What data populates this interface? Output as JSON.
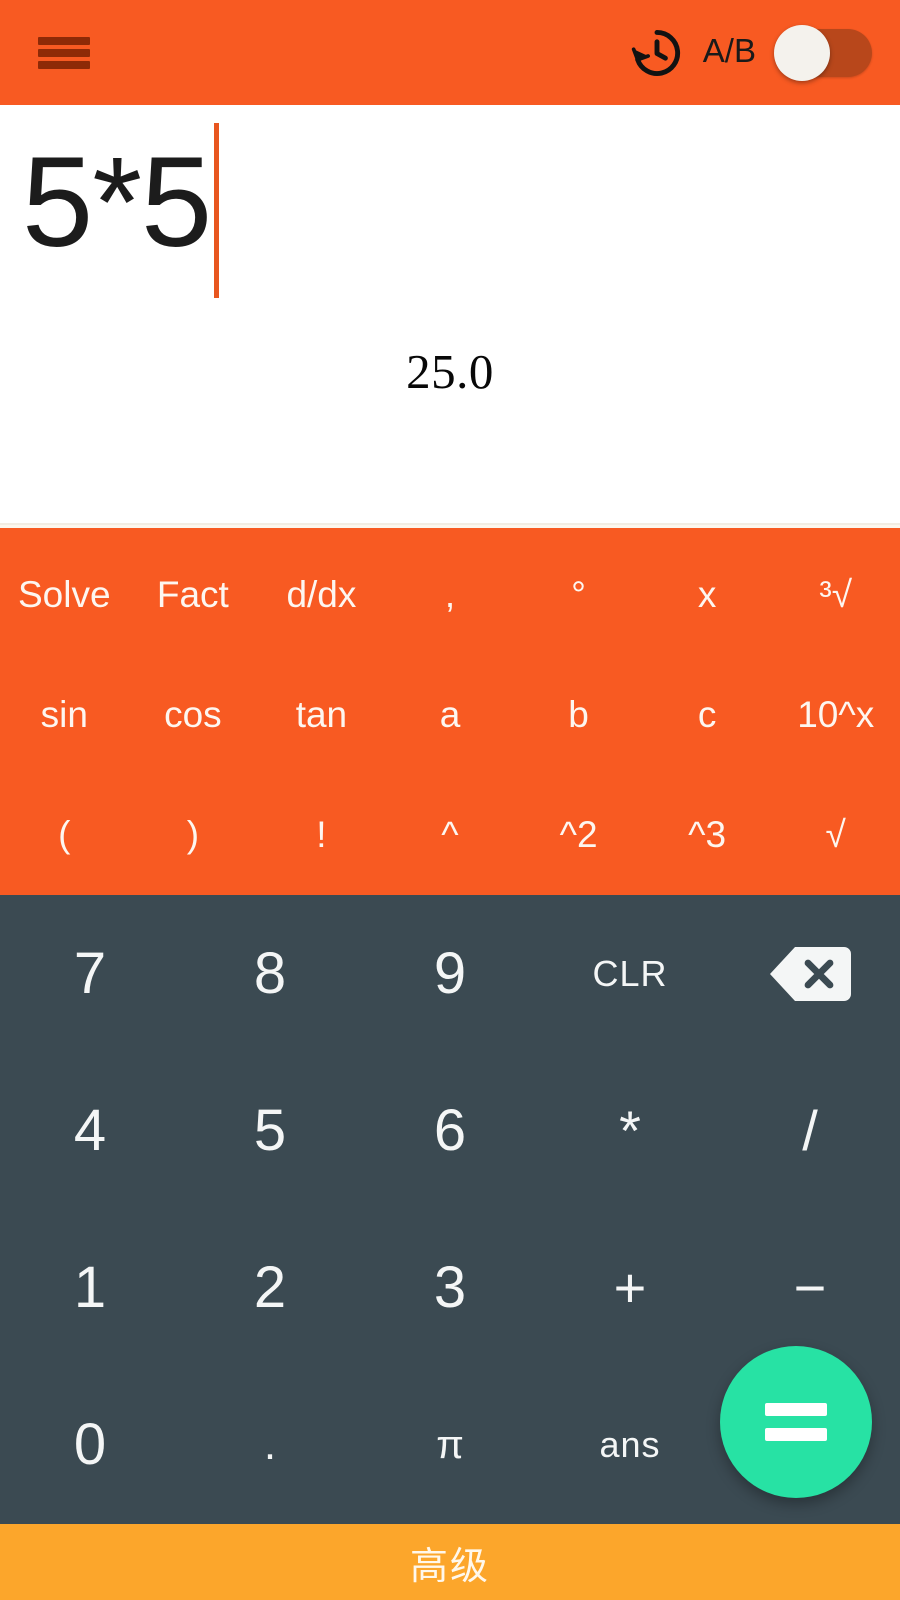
{
  "appbar": {
    "menu_icon": "hamburger-menu-icon",
    "history_icon": "history-restore-icon",
    "mode_label": "A/B",
    "toggle_state": "off"
  },
  "display": {
    "expression": "5*5",
    "result": "25.0",
    "caret_color": "#E8561F"
  },
  "function_panel": {
    "rows": [
      [
        {
          "label": "Solve",
          "name": "solve"
        },
        {
          "label": "Fact",
          "name": "fact"
        },
        {
          "label": "d/dx",
          "name": "ddx"
        },
        {
          "label": ",",
          "name": "comma"
        },
        {
          "label": "°",
          "name": "degree"
        },
        {
          "label": "x",
          "name": "variable-x"
        },
        {
          "label": "³√",
          "name": "cube-root"
        }
      ],
      [
        {
          "label": "sin",
          "name": "sin"
        },
        {
          "label": "cos",
          "name": "cos"
        },
        {
          "label": "tan",
          "name": "tan"
        },
        {
          "label": "a",
          "name": "variable-a"
        },
        {
          "label": "b",
          "name": "variable-b"
        },
        {
          "label": "c",
          "name": "variable-c"
        },
        {
          "label": "10^x",
          "name": "ten-pow-x"
        }
      ],
      [
        {
          "label": "(",
          "name": "open-paren"
        },
        {
          "label": ")",
          "name": "close-paren"
        },
        {
          "label": "!",
          "name": "factorial"
        },
        {
          "label": "^",
          "name": "power"
        },
        {
          "label": "^2",
          "name": "square"
        },
        {
          "label": "^3",
          "name": "cube"
        },
        {
          "label": "√",
          "name": "square-root"
        }
      ]
    ]
  },
  "keypad": {
    "rows": [
      [
        {
          "label": "7",
          "name": "digit-7"
        },
        {
          "label": "8",
          "name": "digit-8"
        },
        {
          "label": "9",
          "name": "digit-9"
        },
        {
          "label": "CLR",
          "name": "clear"
        },
        {
          "label": "",
          "name": "backspace-icon"
        }
      ],
      [
        {
          "label": "4",
          "name": "digit-4"
        },
        {
          "label": "5",
          "name": "digit-5"
        },
        {
          "label": "6",
          "name": "digit-6"
        },
        {
          "label": "*",
          "name": "multiply"
        },
        {
          "label": "/",
          "name": "divide"
        }
      ],
      [
        {
          "label": "1",
          "name": "digit-1"
        },
        {
          "label": "2",
          "name": "digit-2"
        },
        {
          "label": "3",
          "name": "digit-3"
        },
        {
          "label": "+",
          "name": "plus"
        },
        {
          "label": "−",
          "name": "minus"
        }
      ],
      [
        {
          "label": "0",
          "name": "digit-0"
        },
        {
          "label": ".",
          "name": "decimal-point"
        },
        {
          "label": "π",
          "name": "pi"
        },
        {
          "label": "ans",
          "name": "answer"
        },
        {
          "label": "",
          "name": "equals-fab-slot"
        }
      ]
    ],
    "equals_icon": "equals-icon"
  },
  "bottom_bar": {
    "label": "高级"
  },
  "colors": {
    "primary_orange": "#F85A22",
    "keypad_dark": "#3B4A52",
    "fab_green": "#27E2A4",
    "bottom_amber": "#FCA62B",
    "menu_icon": "#8E2A07"
  }
}
